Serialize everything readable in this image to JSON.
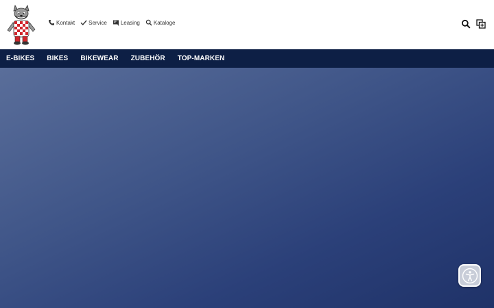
{
  "utility_nav": [
    {
      "label": "Kontakt",
      "icon": "phone-icon"
    },
    {
      "label": "Service",
      "icon": "check-icon"
    },
    {
      "label": "Leasing",
      "icon": "leasing-icon"
    },
    {
      "label": "Kataloge",
      "icon": "search-icon"
    }
  ],
  "header_tools": [
    {
      "icon": "search-icon"
    },
    {
      "icon": "compare-icon"
    }
  ],
  "main_nav": [
    {
      "label": "E-BIKES"
    },
    {
      "label": "BIKES"
    },
    {
      "label": "BIKEWEAR"
    },
    {
      "label": "ZUBEHÖR"
    },
    {
      "label": "TOP-MARKEN"
    }
  ],
  "colors": {
    "nav_background": "#0d1f45",
    "hero_top": "#5a6e9a",
    "hero_bottom": "#1f3268",
    "logo_red": "#d0252b"
  },
  "accessibility_button": {
    "icon": "accessibility-icon"
  }
}
